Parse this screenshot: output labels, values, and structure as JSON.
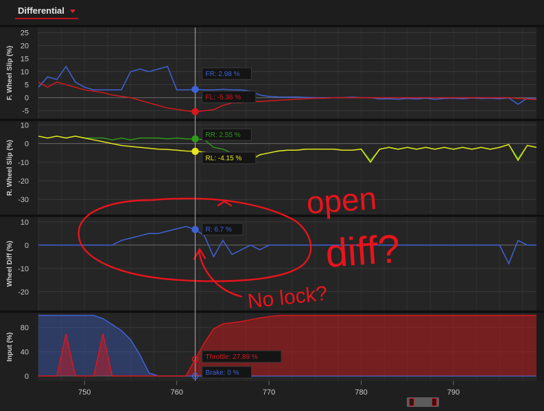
{
  "tab": {
    "label": "Differential"
  },
  "cursor_x": 762,
  "x_axis": {
    "range": [
      745,
      799
    ],
    "ticks": [
      750,
      760,
      770,
      780,
      790
    ]
  },
  "colors": {
    "accent": "#c0121b",
    "blue": "#3f63d6",
    "red": "#d6191c",
    "green": "#2f9a1a",
    "yellow": "#e8e61c",
    "annotation": "#e8141c"
  },
  "annotation": {
    "text_open": "open",
    "text_diff": "diff?",
    "text_nolock": "No lock?"
  },
  "chart_data": [
    {
      "type": "line",
      "ylabel": "F. Wheel Slip (%)",
      "ylim": [
        -8,
        27
      ],
      "yticks": [
        -5,
        0,
        5,
        10,
        15,
        20,
        25
      ],
      "series": [
        {
          "name": "FR",
          "color": "#3f63d6",
          "x": [
            745,
            746,
            747,
            748,
            749,
            750,
            751,
            752,
            753,
            754,
            755,
            756,
            757,
            758,
            759,
            760,
            761,
            762,
            763,
            764,
            765,
            766,
            767,
            768,
            769,
            770,
            771,
            772,
            773,
            774,
            775,
            776,
            777,
            778,
            779,
            780,
            781,
            782,
            783,
            784,
            785,
            786,
            787,
            788,
            789,
            790,
            791,
            792,
            793,
            794,
            795,
            796,
            797,
            798,
            799
          ],
          "y": [
            4,
            8,
            7,
            12,
            6,
            4,
            3,
            3,
            3,
            3,
            10,
            11,
            10,
            11,
            12,
            3,
            3,
            3.2,
            3,
            3,
            3.2,
            3,
            3,
            2.5,
            1,
            0.5,
            0.3,
            0.2,
            0.3,
            0.1,
            0,
            0,
            0,
            0,
            0.2,
            0,
            0,
            -0.5,
            -0.4,
            -0.6,
            -0.3,
            -0.5,
            -0.2,
            -0.6,
            -0.3,
            -0.2,
            -0.4,
            -0.1,
            -0.3,
            -0.2,
            -0.4,
            -0.1,
            -2.5,
            -0.2,
            -0.5
          ]
        },
        {
          "name": "FL",
          "color": "#d6191c",
          "x": [
            745,
            746,
            747,
            748,
            749,
            750,
            751,
            752,
            753,
            754,
            755,
            756,
            757,
            758,
            759,
            760,
            761,
            762,
            763,
            764,
            765,
            766,
            767,
            768,
            769,
            770,
            771,
            772,
            773,
            774,
            775,
            776,
            777,
            778,
            779,
            780,
            781,
            782,
            783,
            784,
            785,
            786,
            787,
            788,
            789,
            790,
            791,
            792,
            793,
            794,
            795,
            796,
            797,
            798,
            799
          ],
          "y": [
            6,
            4,
            6,
            5,
            4,
            3,
            2.5,
            2,
            1,
            0.5,
            0,
            -1,
            -2,
            -3,
            -4,
            -4.5,
            -5,
            -5.36,
            -5,
            -4.6,
            -3,
            -2,
            -2,
            -1.5,
            -1.5,
            -1.2,
            -1,
            -0.8,
            -0.6,
            -0.4,
            -0.2,
            -0.2,
            0,
            0,
            0,
            0,
            0,
            0,
            0,
            0,
            0,
            0,
            0,
            0,
            0,
            0,
            0,
            0,
            0,
            0,
            0,
            0,
            -0.3,
            -0.5,
            -0.7
          ]
        }
      ],
      "tooltips": [
        {
          "text": "FR: 2.98 %",
          "series": 0
        },
        {
          "text": "FL: -5.36 %",
          "series": 1
        }
      ]
    },
    {
      "type": "line",
      "ylabel": "R. Wheel Slip (%)",
      "ylim": [
        -38,
        12
      ],
      "yticks": [
        -30,
        -20,
        -10,
        0,
        10
      ],
      "series": [
        {
          "name": "RR",
          "color": "#2f9a1a",
          "x": [
            745,
            746,
            747,
            748,
            749,
            750,
            751,
            752,
            753,
            754,
            755,
            756,
            757,
            758,
            759,
            760,
            761,
            762,
            763,
            764,
            765,
            766,
            767,
            768,
            769,
            770,
            771,
            772,
            773,
            774,
            775,
            776,
            777,
            778,
            779,
            780,
            781,
            782,
            783,
            784,
            785,
            786,
            787,
            788,
            789,
            790,
            791,
            792,
            793,
            794,
            795,
            796,
            797,
            798,
            799
          ],
          "y": [
            4,
            3,
            4,
            3,
            4,
            3,
            3,
            3,
            2,
            3,
            2,
            3,
            3,
            3,
            2.5,
            3,
            2.5,
            2.55,
            2,
            -2,
            -3,
            -5,
            -7,
            -9,
            -6,
            -5,
            -4,
            -3.5,
            -3.5,
            -3,
            -3,
            -3,
            -3,
            -3.5,
            -3.5,
            -3,
            -9,
            -3,
            -2,
            -3,
            -2,
            -3,
            -2,
            -3,
            -2,
            -3,
            -2,
            -3,
            -2,
            -3,
            -2,
            -0.5,
            -8,
            -1,
            -2
          ]
        },
        {
          "name": "RL",
          "color": "#e8e61c",
          "x": [
            745,
            746,
            747,
            748,
            749,
            750,
            751,
            752,
            753,
            754,
            755,
            756,
            757,
            758,
            759,
            760,
            761,
            762,
            763,
            764,
            765,
            766,
            767,
            768,
            769,
            770,
            771,
            772,
            773,
            774,
            775,
            776,
            777,
            778,
            779,
            780,
            781,
            782,
            783,
            784,
            785,
            786,
            787,
            788,
            789,
            790,
            791,
            792,
            793,
            794,
            795,
            796,
            797,
            798,
            799
          ],
          "y": [
            4,
            3,
            4,
            3,
            4,
            3,
            2,
            1,
            0,
            -1,
            -1.5,
            -2,
            -2.5,
            -3,
            -3.2,
            -3.5,
            -4,
            -4.15,
            -4.5,
            -5,
            -6,
            -7,
            -8,
            -9,
            -6,
            -5,
            -4,
            -3.5,
            -3.5,
            -3,
            -3,
            -3,
            -3,
            -3.5,
            -3.5,
            -3,
            -10,
            -3,
            -2,
            -3,
            -2,
            -3,
            -2,
            -3,
            -2,
            -3,
            -2,
            -3,
            -2,
            -3,
            -2,
            -0.5,
            -9,
            -1,
            -2
          ]
        }
      ],
      "tooltips": [
        {
          "text": "RR: 2.55 %",
          "series": 0
        },
        {
          "text": "RL: -4.15 %",
          "series": 1
        }
      ]
    },
    {
      "type": "line",
      "ylabel": "Wheel Diff (%)",
      "ylim": [
        -28,
        12
      ],
      "yticks": [
        -20,
        -10,
        0,
        10
      ],
      "series": [
        {
          "name": "R",
          "color": "#3f63d6",
          "x": [
            745,
            746,
            747,
            748,
            749,
            750,
            751,
            752,
            753,
            754,
            755,
            756,
            757,
            758,
            759,
            760,
            761,
            762,
            763,
            764,
            765,
            766,
            767,
            768,
            769,
            770,
            771,
            772,
            773,
            774,
            775,
            776,
            777,
            778,
            779,
            780,
            781,
            782,
            783,
            784,
            785,
            786,
            787,
            788,
            789,
            790,
            791,
            792,
            793,
            794,
            795,
            796,
            797,
            798,
            799
          ],
          "y": [
            0,
            0,
            0,
            0,
            0,
            0,
            0,
            0,
            0,
            2,
            3,
            4,
            5,
            5,
            6,
            7,
            8,
            6.7,
            4,
            -5,
            2,
            -4,
            -2,
            0,
            -2,
            0,
            0,
            0,
            0,
            0,
            0,
            0,
            0,
            0,
            0,
            0,
            0,
            0,
            0,
            0,
            0,
            0,
            0,
            0,
            0,
            0,
            0,
            0,
            0,
            0,
            0,
            -8,
            2,
            0,
            0
          ]
        }
      ],
      "tooltips": [
        {
          "text": "R: 6.7 %",
          "series": 0
        }
      ]
    },
    {
      "type": "area",
      "ylabel": "Input (%)",
      "ylim": [
        -8,
        104
      ],
      "yticks": [
        0,
        40,
        80
      ],
      "series": [
        {
          "name": "Throttle",
          "color": "#d6191c",
          "x": [
            745,
            746,
            747,
            748,
            749,
            750,
            751,
            752,
            753,
            754,
            755,
            756,
            757,
            758,
            759,
            760,
            761,
            762,
            763,
            764,
            765,
            766,
            767,
            768,
            769,
            770,
            771,
            772,
            773,
            774,
            775,
            776,
            777,
            778,
            779,
            780,
            781,
            782,
            783,
            784,
            785,
            786,
            787,
            788,
            789,
            790,
            791,
            792,
            793,
            794,
            795,
            796,
            797,
            798,
            799
          ],
          "y": [
            0,
            0,
            0,
            70,
            0,
            0,
            0,
            70,
            0,
            0,
            0,
            0,
            0,
            0,
            0,
            0,
            0,
            27.89,
            55,
            78,
            86,
            88,
            90,
            93,
            96,
            98,
            100,
            100,
            100,
            100,
            100,
            100,
            100,
            100,
            100,
            100,
            100,
            100,
            100,
            100,
            100,
            100,
            100,
            100,
            100,
            100,
            100,
            100,
            100,
            100,
            100,
            100,
            100,
            100,
            100
          ]
        },
        {
          "name": "Brake",
          "color": "#3f63d6",
          "x": [
            745,
            746,
            747,
            748,
            749,
            750,
            751,
            752,
            753,
            754,
            755,
            756,
            757,
            758,
            759,
            760,
            761,
            762,
            763,
            764,
            765,
            766,
            767,
            768,
            769,
            770,
            771,
            772,
            773,
            774,
            775,
            776,
            777,
            778,
            779,
            780,
            781,
            782,
            783,
            784,
            785,
            786,
            787,
            788,
            789,
            790,
            791,
            792,
            793,
            794,
            795,
            796,
            797,
            798,
            799
          ],
          "y": [
            100,
            100,
            100,
            100,
            100,
            100,
            100,
            95,
            85,
            75,
            60,
            35,
            5,
            0,
            0,
            0,
            0,
            0,
            0,
            0,
            0,
            0,
            0,
            0,
            0,
            0,
            0,
            0,
            0,
            0,
            0,
            0,
            0,
            0,
            0,
            0,
            0,
            0,
            0,
            0,
            0,
            0,
            0,
            0,
            0,
            0,
            0,
            0,
            0,
            0,
            0,
            0,
            0,
            0,
            0
          ]
        }
      ],
      "tooltips": [
        {
          "text": "Throttle: 27.89 %",
          "series": 0
        },
        {
          "text": "Brake: 0 %",
          "series": 1
        }
      ]
    }
  ]
}
